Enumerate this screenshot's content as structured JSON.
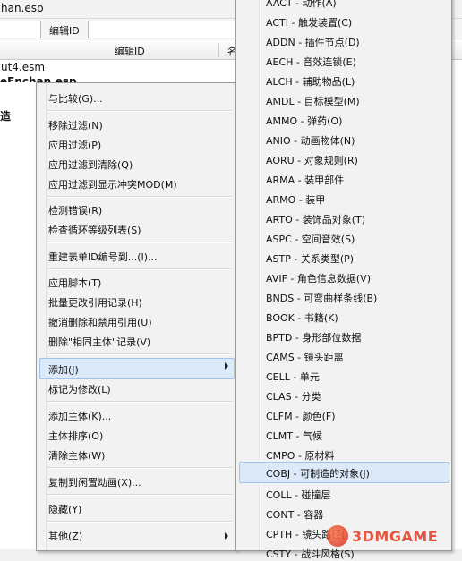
{
  "window": {
    "title": "han.esp",
    "filter_label": "编辑ID",
    "columns": [
      "编辑ID",
      "名"
    ],
    "rows": [
      "ut4.esm",
      "eEnchan.esp",
      "造"
    ]
  },
  "main_menu": {
    "items": [
      "与比较(G)...",
      "移除过滤(N)",
      "应用过滤(P)",
      "应用过滤到清除(Q)",
      "应用过滤到显示冲突MOD(M)",
      "检测错误(R)",
      "检查循环等级列表(S)",
      "重建表单ID编号到...(I)...",
      "应用脚本(T)",
      "批量更改引用记录(H)",
      "撤消删除和禁用引用(U)",
      "删除\"相同主体\"记录(V)",
      "添加(J)",
      "标记为修改(L)",
      "添加主体(K)...",
      "主体排序(O)",
      "清除主体(W)",
      "复制到闲置动画(X)...",
      "隐藏(Y)",
      "其他(Z)"
    ],
    "highlighted": "添加(J)"
  },
  "sub_menu": {
    "items": [
      "AACT - 动作(A)",
      "ACTI - 触发装置(C)",
      "ADDN - 插件节点(D)",
      "AECH - 音效连锁(E)",
      "ALCH - 辅助物品(L)",
      "AMDL - 目标模型(M)",
      "AMMO - 弹药(O)",
      "ANIO - 动画物体(N)",
      "AORU - 对象规则(R)",
      "ARMA - 装甲部件",
      "ARMO - 装甲",
      "ARTO - 装饰品对象(T)",
      "ASPC - 空间音效(S)",
      "ASTP - 关系类型(P)",
      "AVIF - 角色信息数据(V)",
      "BNDS - 可弯曲样条线(B)",
      "BOOK - 书籍(K)",
      "BPTD - 身形部位数据",
      "CAMS - 镜头距离",
      "CELL - 单元",
      "CLAS - 分类",
      "CLFM - 颜色(F)",
      "CLMT - 气候",
      "CMPO - 原材料",
      "COBJ - 可制造的对象(J)",
      "COLL - 碰撞层",
      "CONT - 容器",
      "CPTH - 镜头路径(",
      "CSTY - 战斗风格(S)"
    ],
    "highlighted": "COBJ - 可制造的对象(J)"
  },
  "watermark": {
    "text": "3DMGAME"
  }
}
